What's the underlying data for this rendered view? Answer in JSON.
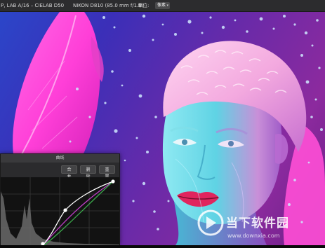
{
  "topbar": {
    "color_mode": "P, LAB A/16 – CIELAB D50",
    "camera": "NIKON D810 (85.0 mm f/1.8)",
    "unit_label": "单位:",
    "unit_value": "像素"
  },
  "curves_panel": {
    "title": "曲线",
    "merge_label": "合并",
    "delete_label": "删除",
    "reset_label": "重置"
  },
  "watermark": {
    "name": "当下软件园",
    "url": "www.downxia.com"
  },
  "colors": {
    "background_blue": "#2b46c9",
    "background_purple": "#8c2a9e",
    "leaf_pink": "#ff3fd8",
    "cap_pink": "#f7b6e4",
    "face_cyan": "#4fd8e6",
    "lips": "#e0255e",
    "curve_composite": "#ffffff",
    "curve_green": "#3aa84a",
    "curve_magenta": "#c040c8"
  }
}
